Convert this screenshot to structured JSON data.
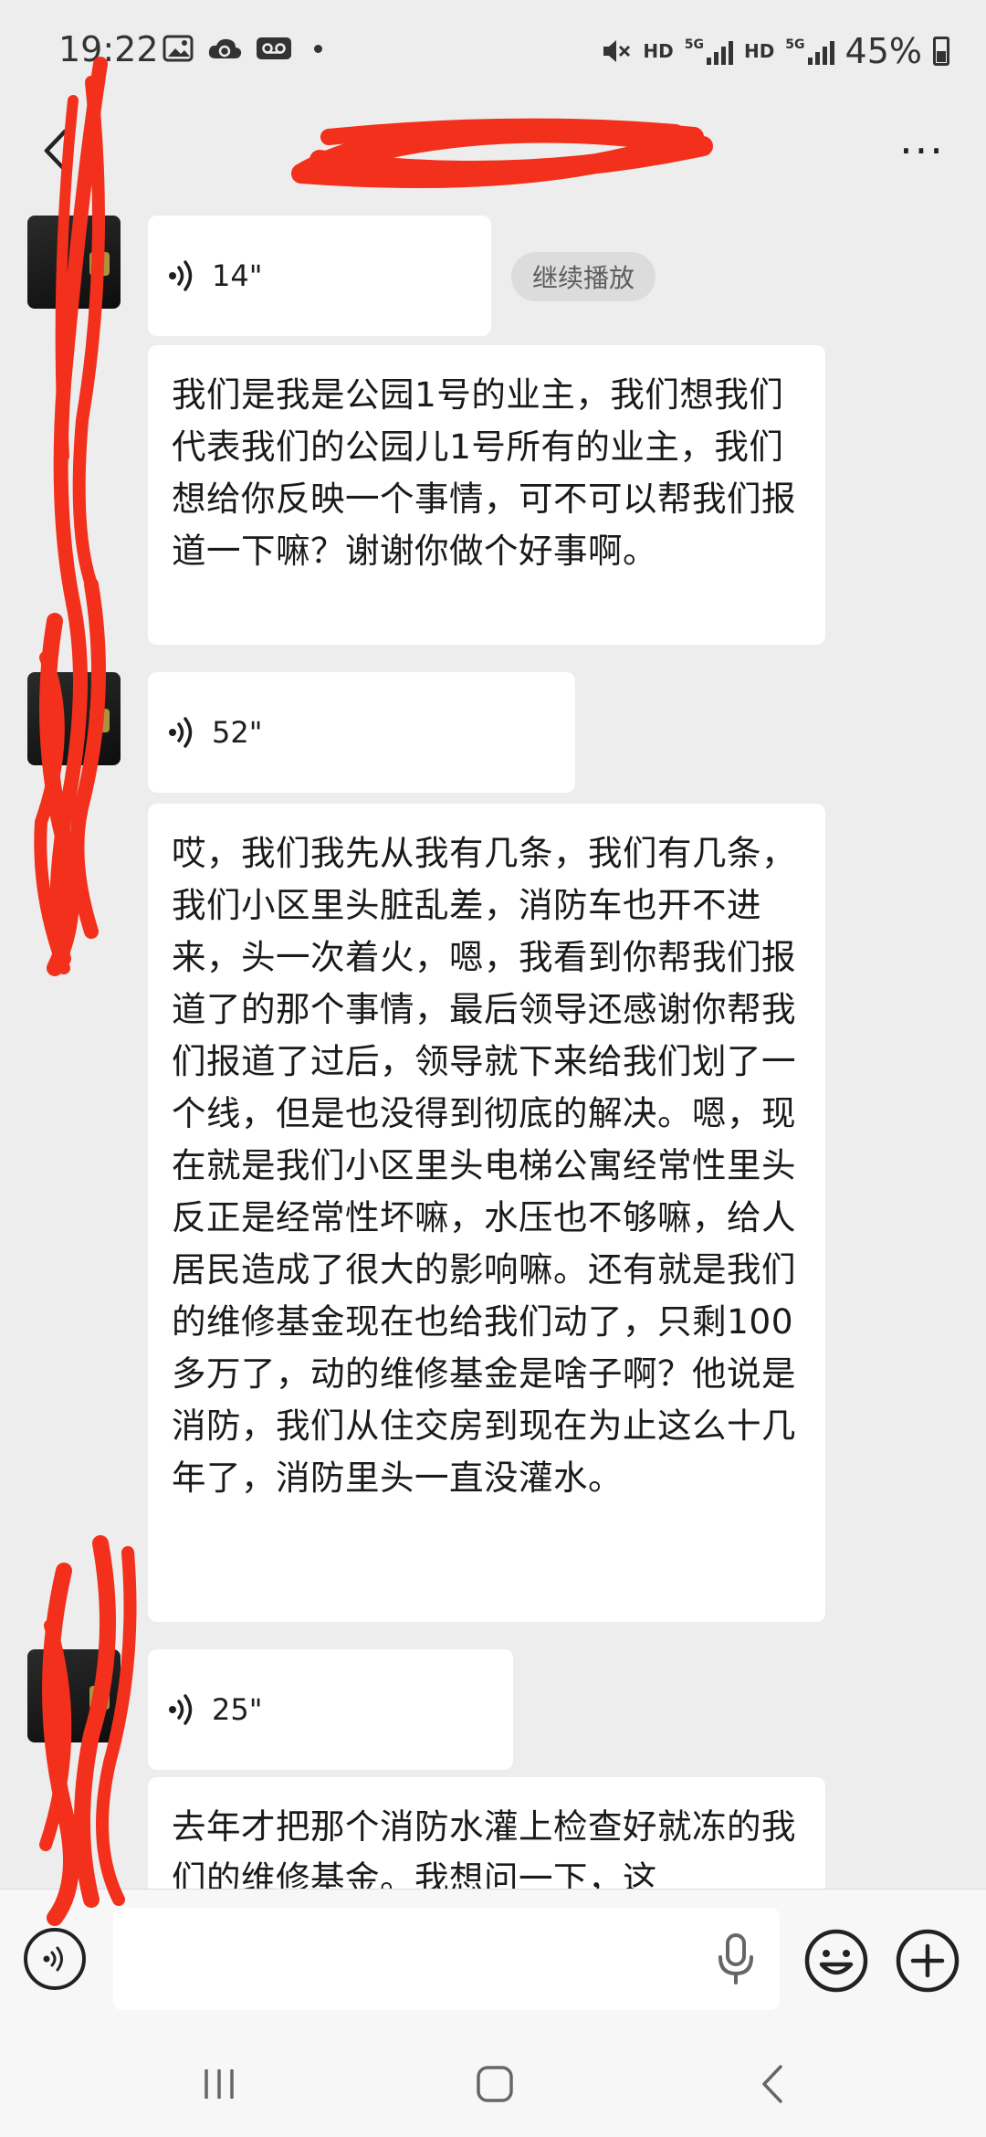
{
  "status_bar": {
    "time": "19:22",
    "battery": "45%",
    "network_1": "HD",
    "network_2": "5G",
    "network_3": "HD",
    "network_4": "5G",
    "icons": [
      "image-icon",
      "cloud-sync-icon",
      "voicemail-icon",
      "mute-icon",
      "signal-icon",
      "battery-icon"
    ]
  },
  "header": {
    "back_icon": "chevron-left-icon",
    "more_label": "···"
  },
  "messages": [
    {
      "type": "voice",
      "duration": "14\""
    },
    {
      "type": "text",
      "text": "我们是我是公园1号的业主，我们想我们代表我们的公园儿1号所有的业主，我们想给你反映一个事情，可不可以帮我们报道一下嘛？谢谢你做个好事啊。"
    },
    {
      "type": "voice",
      "duration": "52\""
    },
    {
      "type": "text",
      "text": "哎，我们我先从我有几条，我们有几条，我们小区里头脏乱差，消防车也开不进来，头一次着火，嗯，我看到你帮我们报道了的那个事情，最后领导还感谢你帮我们报道了过后，领导就下来给我们划了一个线，但是也没得到彻底的解决。嗯，现在就是我们小区里头电梯公寓经常性里头反正是经常性坏嘛，水压也不够嘛，给人居民造成了很大的影响嘛。还有就是我们的维修基金现在也给我们动了，只剩100多万了，动的维修基金是啥子啊？他说是消防，我们从住交房到现在为止这么十几年了，消防里头一直没灌水。"
    },
    {
      "type": "voice",
      "duration": "25\""
    },
    {
      "type": "text",
      "text": "去年才把那个消防水灌上检查好就冻的我们的维修基金。我想问一下，这"
    }
  ],
  "continue_playback": "继续播放",
  "colors": {
    "background": "#ededed",
    "bubble": "#ffffff",
    "redaction": "#f2301c"
  }
}
